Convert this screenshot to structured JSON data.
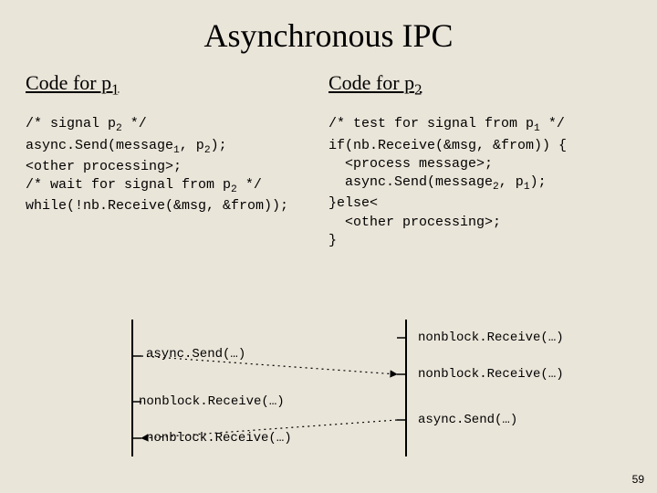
{
  "title": "Asynchronous IPC",
  "left": {
    "heading_a": "Code for p",
    "heading_sub": "1",
    "line1a": "/* signal p",
    "line1b": " */",
    "line2a": "async.Send(message",
    "line2b": ", p",
    "line2c": ");",
    "line3": "<other processing>;",
    "line4a": "/* wait for signal from p",
    "line4b": " */",
    "line5": "while(!nb.Receive(&msg, &from));",
    "sub1": "1",
    "sub2": "2"
  },
  "right": {
    "heading_a": "Code for p",
    "heading_sub": "2",
    "line1a": "/* test for signal from p",
    "line1b": " */",
    "line2": "if(nb.Receive(&msg, &from)) {",
    "line3": "  <process message>;",
    "line4a": "  async.Send(message",
    "line4b": ", p",
    "line4c": ");",
    "line5": "}else<",
    "line6": "  <other processing>;",
    "line7": "}",
    "sub1": "1",
    "sub2": "2"
  },
  "diagram": {
    "l1": "async.Send(…)",
    "l2": "nonblock.Receive(…)",
    "l3": "nonblock.Receive(…)",
    "r1": "nonblock.Receive(…)",
    "r2": "nonblock.Receive(…)",
    "r3": "async.Send(…)"
  },
  "pageno": "59"
}
